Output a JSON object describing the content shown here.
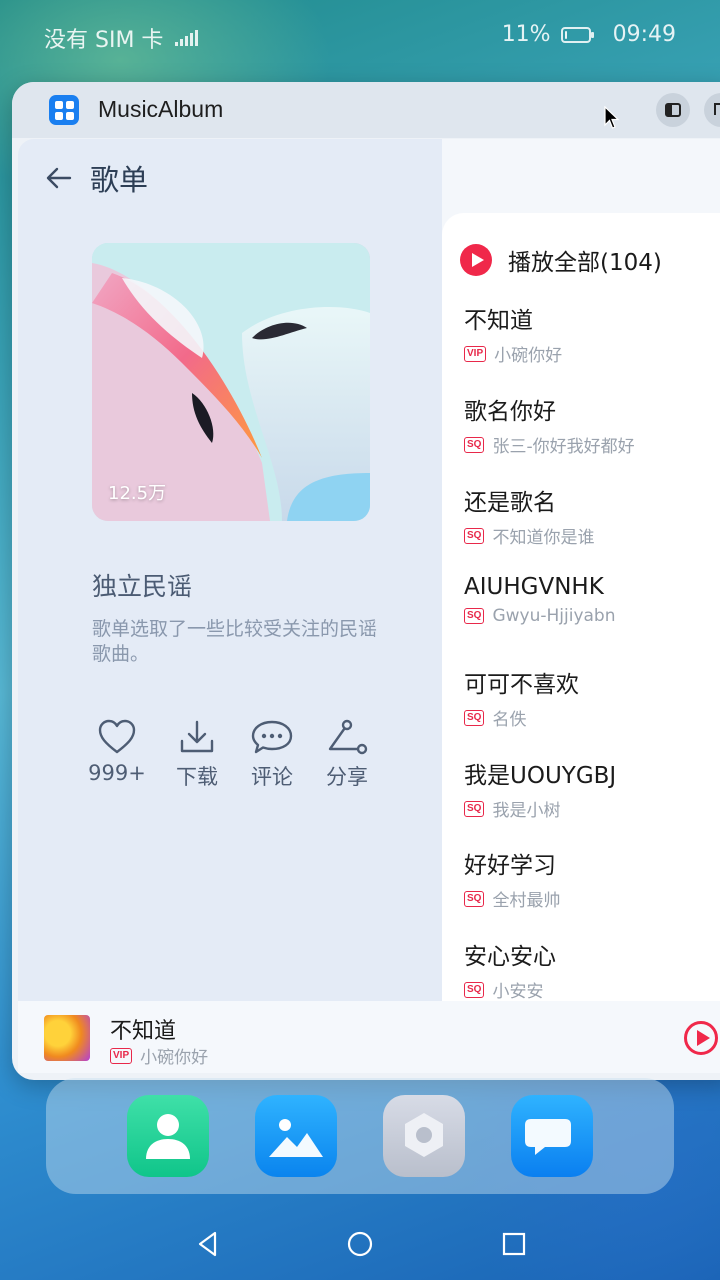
{
  "status_bar": {
    "carrier": "没有 SIM 卡",
    "battery": "11%",
    "battery_level": 0.11,
    "time": "09:49"
  },
  "window": {
    "app_title": "MusicAlbum"
  },
  "playlist": {
    "page_title": "歌单",
    "play_count": "12.5万",
    "name": "独立民谣",
    "description": "歌单选取了一些比较受关注的民谣歌曲。",
    "actions": {
      "like": "999+",
      "download": "下载",
      "comment": "评论",
      "share": "分享"
    }
  },
  "song_list": {
    "play_all": "播放全部(104)",
    "songs": [
      {
        "title": "不知道",
        "badge": "VIP",
        "artist": "小碗你好"
      },
      {
        "title": "歌名你好",
        "badge": "SQ",
        "artist": "张三-你好我好都好"
      },
      {
        "title": "还是歌名",
        "badge": "SQ",
        "artist": "不知道你是谁"
      },
      {
        "title": "AIUHGVNHK",
        "badge": "SQ",
        "artist": "Gwyu-Hjjiyabn"
      },
      {
        "title": "可可不喜欢",
        "badge": "SQ",
        "artist": "名佚"
      },
      {
        "title": "我是UOUYGBJ",
        "badge": "SQ",
        "artist": "我是小树"
      },
      {
        "title": "好好学习",
        "badge": "SQ",
        "artist": "全村最帅"
      },
      {
        "title": "安心安心",
        "badge": "SQ",
        "artist": "小安安"
      }
    ]
  },
  "mini_player": {
    "title": "不知道",
    "badge": "VIP",
    "artist": "小碗你好"
  },
  "dock": {
    "apps": [
      "contacts-icon",
      "gallery-icon",
      "settings-icon",
      "messages-icon"
    ]
  },
  "colors": {
    "accent": "#f0284a",
    "pane": "#e4ebf6"
  }
}
